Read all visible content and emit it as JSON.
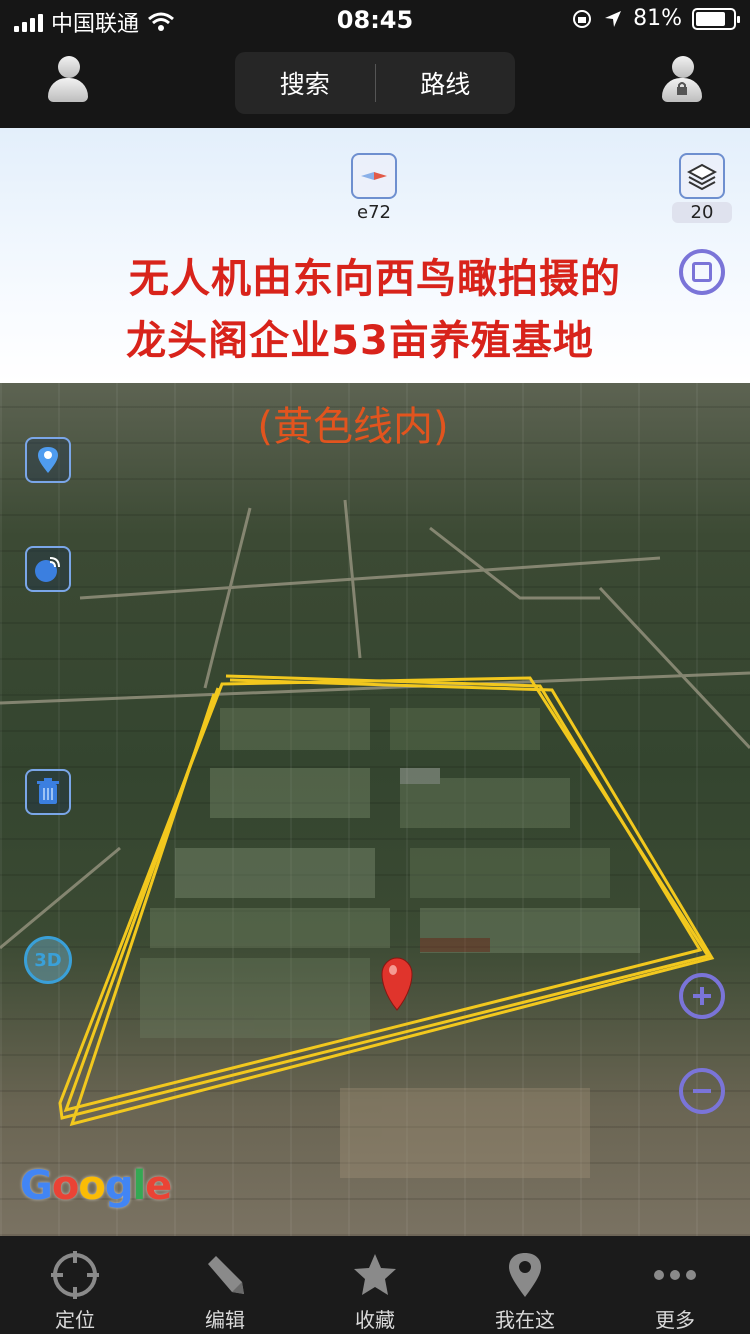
{
  "status_bar": {
    "carrier": "中国联通",
    "time": "08:45",
    "battery_percent": "81%",
    "battery_level": 0.81
  },
  "top_bar": {
    "search_label": "搜索",
    "route_label": "路线"
  },
  "map": {
    "compass_label": "e72",
    "layers_count": "20",
    "caption_line1": "无人机由东向西鸟瞰拍摄的",
    "caption_line2": "龙头阁企业53亩养殖基地",
    "caption_line3": "(黄色线内)",
    "threed_label": "3D",
    "google_logo": "Google"
  },
  "tab_bar": {
    "items": [
      {
        "label": "定位",
        "icon": "crosshair-icon"
      },
      {
        "label": "编辑",
        "icon": "pencil-icon"
      },
      {
        "label": "收藏",
        "icon": "star-icon"
      },
      {
        "label": "我在这",
        "icon": "map-pin-icon"
      },
      {
        "label": "更多",
        "icon": "more-dots-icon"
      }
    ]
  },
  "colors": {
    "caption_red": "#d8231b",
    "boundary_yellow": "#f2c81e",
    "control_purple": "#7a74d8"
  }
}
